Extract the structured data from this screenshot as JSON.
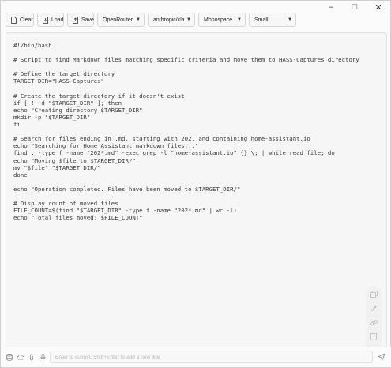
{
  "toolbar": {
    "clear_label": "Clear",
    "load_label": "Load",
    "save_label": "Save",
    "provider_select": "OpenRouter",
    "model_select": "anthropic/claude",
    "font_select": "Monospace",
    "size_select": "Small"
  },
  "window_controls": {
    "minimize": "–",
    "maximize": "□",
    "close": "✕"
  },
  "editor": {
    "lines": [
      "#!/bin/bash",
      "",
      "# Script to find Markdown files matching specific criteria and move them to HASS-Captures directory",
      "",
      "# Define the target directory",
      "TARGET_DIR=\"HASS-Captures\"",
      "",
      "# Create the target directory if it doesn't exist",
      "if [ ! -d \"$TARGET_DIR\" ]; then",
      "echo \"Creating directory $TARGET_DIR\"",
      "mkdir -p \"$TARGET_DIR\"",
      "fi",
      "",
      "# Search for files ending in .md, starting with 202, and containing home-assistant.io",
      "echo \"Searching for Home Assistant markdown files...\"",
      "find . -type f -name \"202*.md\" -exec grep -l \"home-assistant.io\" {} \\; | while read file; do",
      "echo \"Moving $file to $TARGET_DIR/\"",
      "mv \"$file\" \"$TARGET_DIR/\"",
      "done",
      "",
      "echo \"Operation completed. Files have been moved to $TARGET_DIR/\"",
      "",
      "# Display count of moved files",
      "FILE_COUNT=$(find \"$TARGET_DIR\" -type f -name \"202*.md\" | wc -l)",
      "echo \"Total files moved: $FILE_COUNT\""
    ]
  },
  "input": {
    "placeholder": "Enter to submit, Shift+Enter to add a new line"
  },
  "icons": {
    "rail": [
      "copy-icon",
      "magic-icon",
      "link-icon",
      "document-icon",
      "minus-icon",
      "undo-icon"
    ],
    "bottom": [
      "database-icon",
      "cloud-icon",
      "attach-icon",
      "microphone-icon"
    ]
  }
}
